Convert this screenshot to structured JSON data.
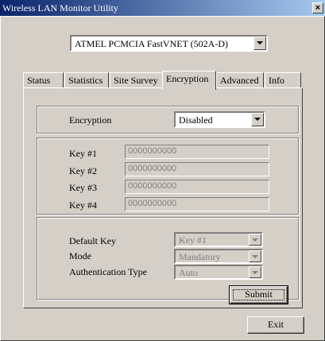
{
  "window": {
    "title": "Wireless LAN Monitor Utility",
    "close_glyph": "×"
  },
  "adapter": {
    "selected": "ATMEL PCMCIA FastVNET (502A-D)"
  },
  "tabs": [
    {
      "label": "Status"
    },
    {
      "label": "Statistics"
    },
    {
      "label": "Site Survey"
    },
    {
      "label": "Encryption"
    },
    {
      "label": "Advanced"
    },
    {
      "label": "Info"
    }
  ],
  "active_tab": "Encryption",
  "encryption": {
    "label": "Encryption",
    "value": "Disabled"
  },
  "keys": [
    {
      "label": "Key #1",
      "value": "0000000000"
    },
    {
      "label": "Key #2",
      "value": "0000000000"
    },
    {
      "label": "Key #3",
      "value": "0000000000"
    },
    {
      "label": "Key #4",
      "value": "0000000000"
    }
  ],
  "settings": {
    "default_key_label": "Default Key",
    "default_key_value": "Key #1",
    "mode_label": "Mode",
    "mode_value": "Mandatory",
    "auth_label": "Authentication Type",
    "auth_value": "Auto"
  },
  "buttons": {
    "submit": "Submit",
    "exit": "Exit"
  },
  "colors": {
    "titlebar_start": "#0a246a",
    "titlebar_end": "#a6caf0",
    "face": "#d4d0c8"
  },
  "icons": {
    "dropdown": "chevron-down-icon",
    "close": "close-icon"
  }
}
